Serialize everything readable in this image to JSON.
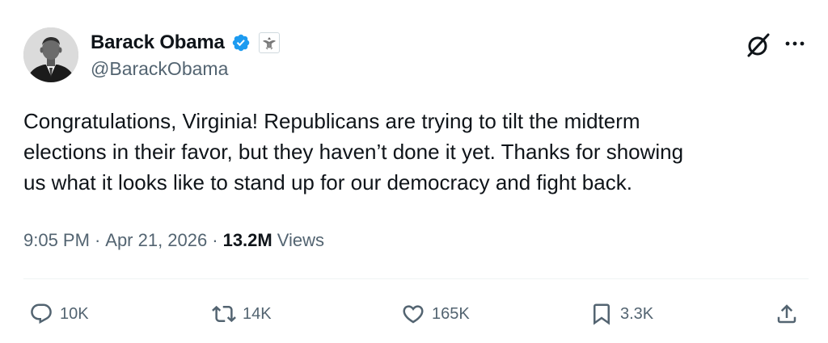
{
  "author": {
    "display_name": "Barack Obama",
    "handle": "@BarackObama",
    "verified": true,
    "verified_color": "#1d9bf0",
    "affiliation_icon": "us-government-seal-icon"
  },
  "tweet": {
    "text": "Congratulations, Virginia! Republicans are trying to tilt the midterm\nelections in their favor, but they haven’t done it yet. Thanks for showing\nus what it looks like to stand up for our democracy and fight back.",
    "time": "9:05 PM",
    "separator1": "·",
    "date": "Apr 21, 2026",
    "separator2": "·",
    "views_count": "13.2M",
    "views_label": "Views"
  },
  "header_actions": {
    "grok_icon": "grok-icon",
    "more_icon": "more-options-icon"
  },
  "actions": {
    "reply_count": "10K",
    "repost_count": "14K",
    "like_count": "165K",
    "bookmark_count": "3.3K",
    "share_icon": "share-icon"
  },
  "colors": {
    "text_primary": "#0f1419",
    "text_secondary": "#536471",
    "divider": "#eff3f4"
  }
}
